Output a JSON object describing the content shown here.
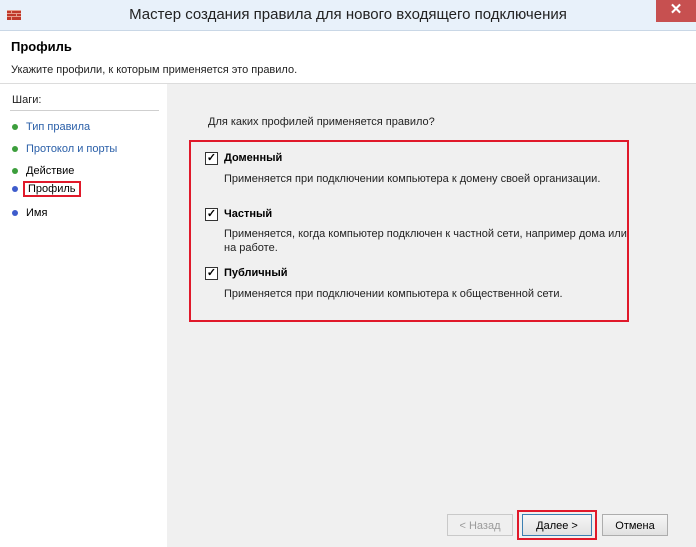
{
  "window": {
    "title": "Мастер создания правила для нового входящего подключения",
    "close_label": "✕"
  },
  "header": {
    "title": "Профиль",
    "description": "Укажите профили, к которым применяется это правило."
  },
  "steps": {
    "heading": "Шаги:",
    "items": [
      {
        "label": "Тип правила",
        "state": "done"
      },
      {
        "label": "Протокол и порты",
        "state": "done"
      },
      {
        "label": "Действие",
        "state": "done"
      },
      {
        "label": "Профиль",
        "state": "current"
      },
      {
        "label": "Имя",
        "state": "pending"
      }
    ]
  },
  "main": {
    "question": "Для каких профилей применяется правило?",
    "profiles": [
      {
        "label": "Доменный",
        "checked": "✓",
        "description": "Применяется при подключении компьютера к домену своей организации."
      },
      {
        "label": "Частный",
        "checked": "✓",
        "description": "Применяется, когда компьютер подключен к частной сети, например дома или на работе."
      },
      {
        "label": "Публичный",
        "checked": "✓",
        "description": "Применяется при подключении компьютера к общественной сети."
      }
    ]
  },
  "buttons": {
    "back": "< Назад",
    "next": "Далее >",
    "cancel": "Отмена"
  },
  "colors": {
    "highlight": "#e0192a",
    "step_done": "#3c9e3c",
    "step_current": "#3e5ccc",
    "link": "#2a5fa8"
  }
}
